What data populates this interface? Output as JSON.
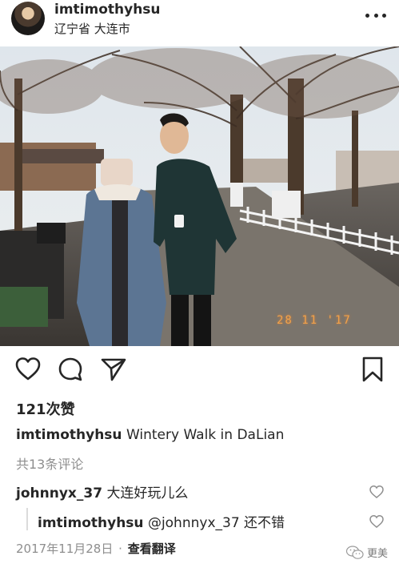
{
  "header": {
    "username": "imtimothyhsu",
    "location": "辽宁省 大连市"
  },
  "photo": {
    "date_stamp": "28 11 '17"
  },
  "actions": {
    "like_icon": "heart-icon",
    "comment_icon": "comment-icon",
    "share_icon": "send-icon",
    "save_icon": "bookmark-icon"
  },
  "likes": "121次赞",
  "caption": {
    "username": "imtimothyhsu",
    "text": "Wintery Walk in DaLian"
  },
  "comments_link": "共13条评论",
  "comments": [
    {
      "username": "johnnyx_37",
      "text": "大连好玩儿么"
    },
    {
      "username": "imtimothyhsu",
      "mention": "@johnnyx_37",
      "text": "还不错"
    }
  ],
  "footer": {
    "date": "2017年11月28日",
    "separator": "·",
    "translate": "查看翻译"
  },
  "watermark": "更美"
}
